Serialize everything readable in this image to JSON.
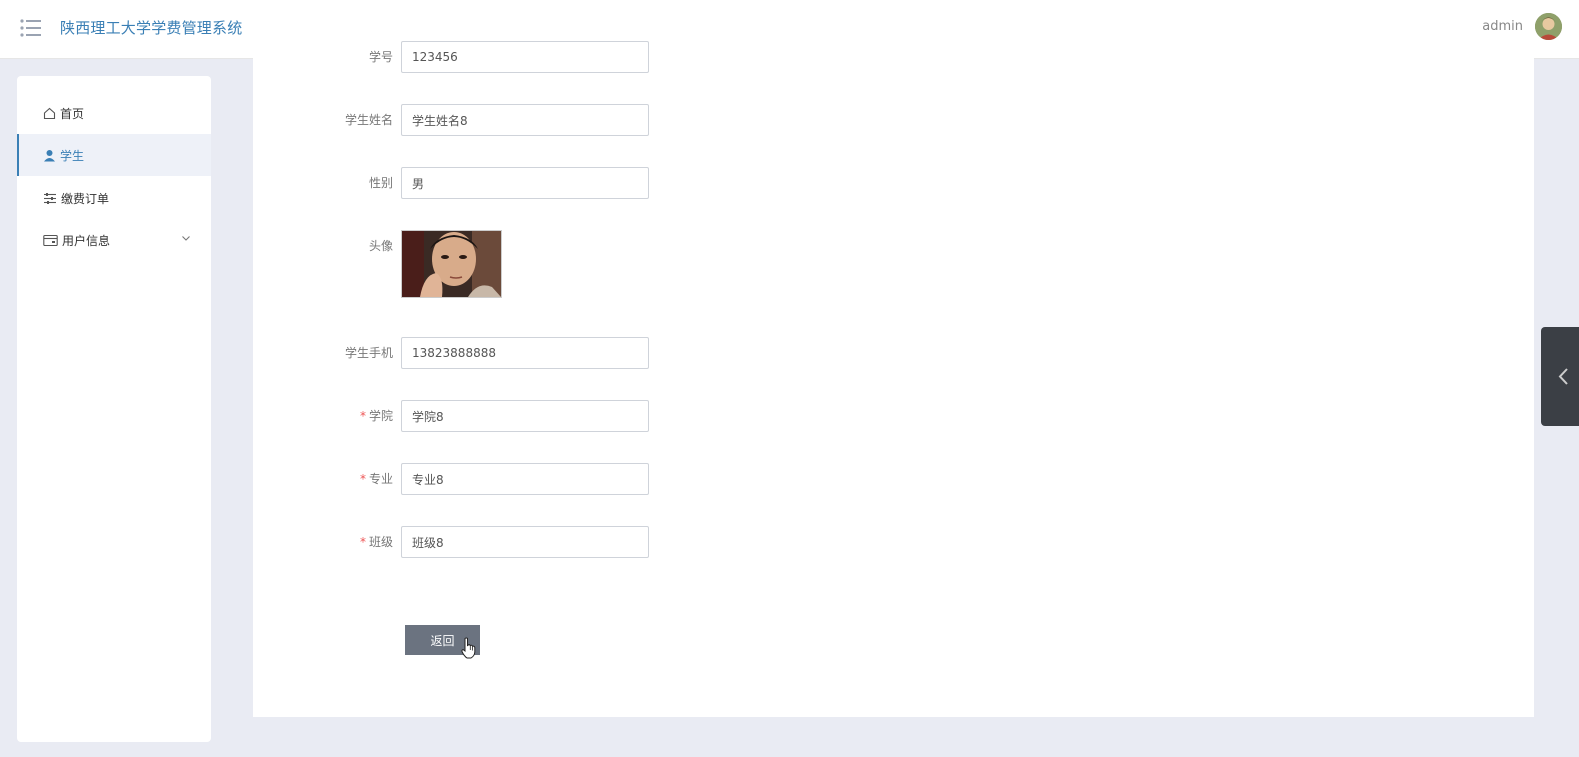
{
  "header": {
    "title": "陕西理工大学学费管理系统",
    "user": "admin"
  },
  "sidebar": {
    "items": [
      {
        "label": "首页",
        "icon": "home-icon"
      },
      {
        "label": "学生",
        "icon": "user-icon",
        "active": true
      },
      {
        "label": "缴费订单",
        "icon": "sliders-icon"
      },
      {
        "label": "用户信息",
        "icon": "wallet-icon",
        "expandable": true
      }
    ]
  },
  "form": {
    "partial_row": {
      "label": "学号",
      "value": "123456"
    },
    "student_name": {
      "label": "学生姓名",
      "value": "学生姓名8"
    },
    "gender": {
      "label": "性别",
      "value": "男"
    },
    "avatar": {
      "label": "头像"
    },
    "phone": {
      "label": "学生手机",
      "value": "13823888888"
    },
    "college": {
      "label": "学院",
      "value": "学院8",
      "required": true
    },
    "major": {
      "label": "专业",
      "value": "专业8",
      "required": true
    },
    "class": {
      "label": "班级",
      "value": "班级8",
      "required": true
    },
    "back_label": "返回"
  },
  "colors": {
    "accent": "#3a7fb5",
    "background": "#e9ebf3",
    "required": "#e55555",
    "button": "#6b7380"
  }
}
